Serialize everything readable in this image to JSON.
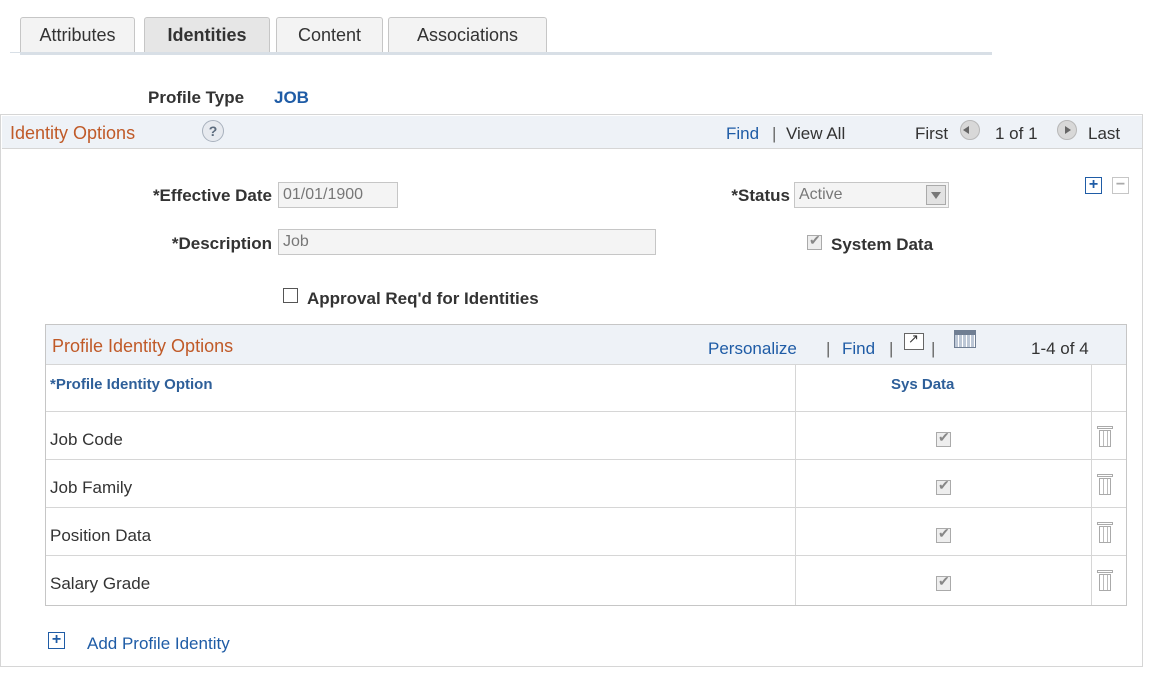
{
  "tabs": [
    {
      "label": "Attributes",
      "active": false
    },
    {
      "label": "Identities",
      "active": true
    },
    {
      "label": "Content",
      "active": false
    },
    {
      "label": "Associations",
      "active": false
    }
  ],
  "profile_type": {
    "label": "Profile Type",
    "value": "JOB"
  },
  "identity_options": {
    "title": "Identity Options",
    "help": "?",
    "find": "Find",
    "sep": "|",
    "view_all": "View All",
    "first": "First",
    "page": "1 of 1",
    "last": "Last",
    "add": "+",
    "delete": "−"
  },
  "form": {
    "effective_date_label": "*Effective Date",
    "effective_date_value": "01/01/1900",
    "status_label": "*Status",
    "status_value": "Active",
    "description_label": "*Description",
    "description_value": "Job",
    "system_data_label": "System Data",
    "approval_label": "Approval Req'd for Identities"
  },
  "grid": {
    "title": "Profile Identity Options",
    "personalize": "Personalize",
    "sep": "|",
    "find": "Find",
    "count": "1-4 of 4",
    "col_option": "*Profile Identity Option",
    "col_sys": "Sys Data",
    "rows": [
      {
        "option": "Job Code",
        "sys_data": true
      },
      {
        "option": "Job Family",
        "sys_data": true
      },
      {
        "option": "Position Data",
        "sys_data": true
      },
      {
        "option": "Salary Grade",
        "sys_data": true
      }
    ]
  },
  "add_profile_identity": {
    "icon": "+",
    "label": "Add Profile Identity"
  },
  "colors": {
    "accent_blue": "#1f5ca6",
    "title_orange": "#c05a28",
    "header_bg": "#eef2f7"
  }
}
